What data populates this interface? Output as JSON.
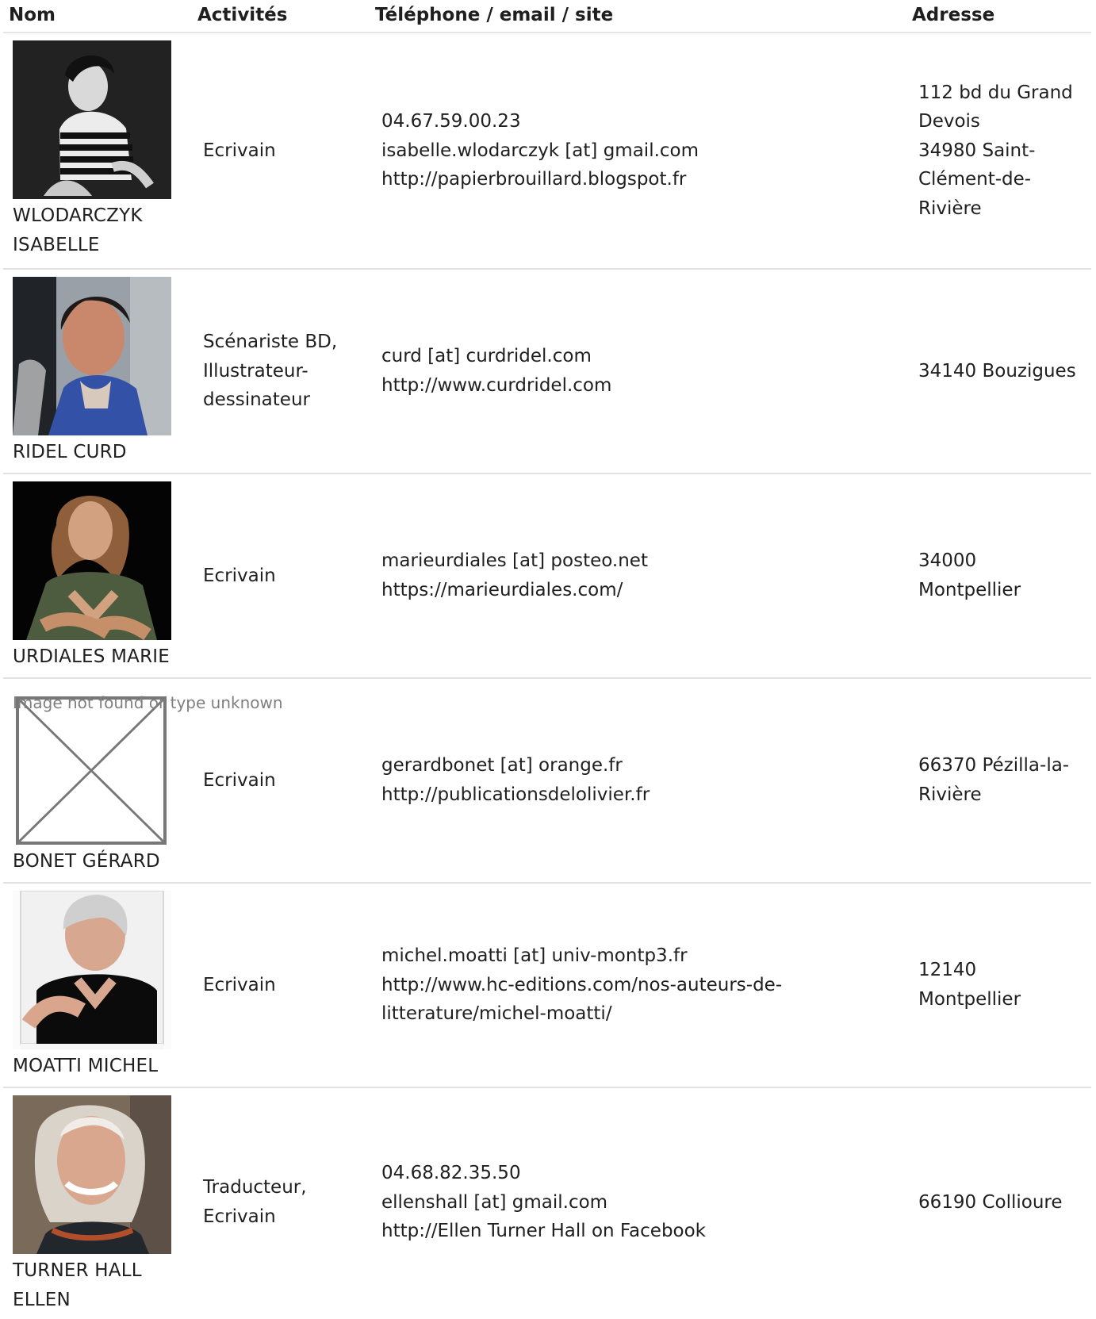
{
  "header": {
    "name": "Nom",
    "activities": "Activités",
    "contact": "Téléphone / email / site",
    "address": "Adresse"
  },
  "broken_image_text": "Image not found or type unknown",
  "people": [
    {
      "name_lines": [
        "WLODARCZYK",
        "ISABELLE"
      ],
      "activities_lines": [
        "Ecrivain"
      ],
      "contact_lines": [
        "04.67.59.00.23",
        "isabelle.wlodarczyk [at] gmail.com",
        "http://papierbrouillard.blogspot.fr"
      ],
      "address_lines": [
        "112 bd du Grand",
        "Devois",
        "34980 Saint-",
        "Clément-de-",
        "Rivière"
      ]
    },
    {
      "name_lines": [
        "RIDEL CURD"
      ],
      "activities_lines": [
        "Scénariste BD,",
        "Illustrateur-",
        "dessinateur"
      ],
      "contact_lines": [
        "curd [at] curdridel.com",
        "http://www.curdridel.com"
      ],
      "address_lines": [
        "34140 Bouzigues"
      ]
    },
    {
      "name_lines": [
        "URDIALES MARIE"
      ],
      "activities_lines": [
        "Ecrivain"
      ],
      "contact_lines": [
        "marieurdiales [at] posteo.net",
        "https://marieurdiales.com/"
      ],
      "address_lines": [
        "34000",
        "Montpellier"
      ]
    },
    {
      "name_lines": [
        "BONET GÉRARD"
      ],
      "activities_lines": [
        "Ecrivain"
      ],
      "contact_lines": [
        "gerardbonet [at] orange.fr",
        "http://publicationsdelolivier.fr"
      ],
      "address_lines": [
        "66370 Pézilla-la-",
        "Rivière"
      ]
    },
    {
      "name_lines": [
        "MOATTI MICHEL"
      ],
      "activities_lines": [
        "Ecrivain"
      ],
      "contact_lines": [
        "michel.moatti [at] univ-montp3.fr",
        "http://www.hc-editions.com/nos-auteurs-de-",
        "litterature/michel-moatti/"
      ],
      "address_lines": [
        "12140",
        "Montpellier"
      ]
    },
    {
      "name_lines": [
        "TURNER HALL",
        "ELLEN"
      ],
      "activities_lines": [
        "Traducteur,",
        "Ecrivain"
      ],
      "contact_lines": [
        "04.68.82.35.50",
        "ellenshall [at] gmail.com",
        "http://Ellen Turner Hall on Facebook"
      ],
      "address_lines": [
        "66190 Collioure"
      ]
    }
  ]
}
